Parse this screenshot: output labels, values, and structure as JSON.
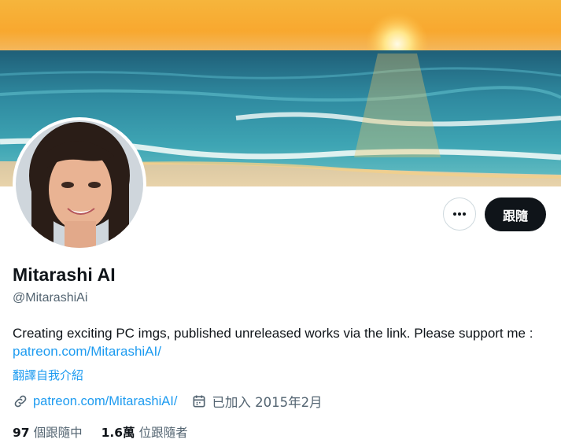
{
  "profile": {
    "name": "Mitarashi AI",
    "handle": "@MitarashiAi",
    "bio_text": "Creating exciting PC imgs, published unreleased works via the link. Please support me : ",
    "bio_link": "patreon.com/MitarashiAI/",
    "translate_label": "翻譯自我介紹",
    "website": "patreon.com/MitarashiAI/",
    "joined": "已加入 2015年2月"
  },
  "actions": {
    "more_icon": "more-horizontal-icon",
    "follow_label": "跟隨"
  },
  "stats": {
    "following_count": "97",
    "following_label": "個跟隨中",
    "followers_count": "1.6萬",
    "followers_label": "位跟隨者"
  },
  "icons": {
    "link": "link-icon",
    "calendar": "calendar-icon"
  },
  "colors": {
    "accent": "#1d9bf0",
    "text": "#0f1419",
    "secondary": "#536471",
    "button": "#0f1419"
  }
}
